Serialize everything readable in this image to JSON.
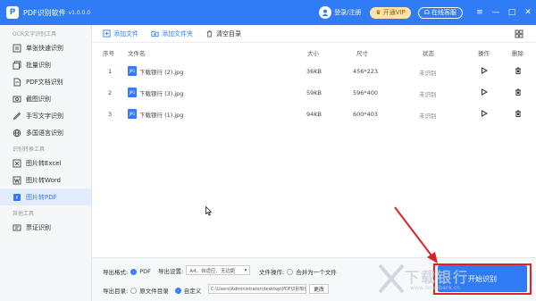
{
  "app": {
    "logo": "P",
    "title": "PDF识别软件",
    "version": "v1.0.0.0"
  },
  "titlebar": {
    "login": "登录/注册",
    "vip": "开通VIP",
    "service": "在线客服",
    "menu": "≡",
    "minimize": "—",
    "maximize": "□",
    "close": "✕"
  },
  "sidebar": {
    "group1": "OCR文字识别工具",
    "items1": [
      "单张快速识别",
      "批量识别",
      "PDF文档识别",
      "截图识别",
      "手写文字识别",
      "多国语言识别"
    ],
    "group2": "识别转换工具",
    "items2": [
      "图片转Excel",
      "图片转Word",
      "图片转PDF"
    ],
    "group3": "其他工具",
    "items3": [
      "票证识别"
    ],
    "active": "图片转PDF"
  },
  "toolbar": {
    "add_file": "添加文件",
    "add_folder": "添加文件夹",
    "clear": "清空目录"
  },
  "table": {
    "headers": {
      "index": "序号",
      "filename": "文件名",
      "size": "大小",
      "dims": "尺寸",
      "status": "状态",
      "action": "操作",
      "delete": "删除"
    },
    "icon_label": "JPG",
    "rows": [
      {
        "index": "1",
        "filename": "下载银行 (2).jpg",
        "size": "36KB",
        "dims": "456*223",
        "status": "未识别"
      },
      {
        "index": "2",
        "filename": "下载银行 (3).jpg",
        "size": "59KB",
        "dims": "596*400",
        "status": "未识别"
      },
      {
        "index": "3",
        "filename": "下载银行 (1).jpg",
        "size": "94KB",
        "dims": "600*403",
        "status": "未识别"
      }
    ]
  },
  "bottom": {
    "format_label": "导出格式:",
    "format_value": "PDF",
    "settings_label": "导出设置:",
    "settings_value": "A4、自适应、无边距",
    "file_op_label": "文件操作:",
    "merge_label": "合并为一个文件",
    "dir_label": "导出目录:",
    "orig_dir": "原文件目录",
    "custom": "自定义",
    "path": "C:\\Users\\Administrator\\desktop\\PDF识别软件",
    "change": "更改",
    "start": "开始识别"
  },
  "watermark": {
    "main": "下载银行",
    "url": "www.downbank.cn"
  },
  "colors": {
    "accent": "#2f7cf6",
    "highlight": "#e0232a",
    "vip": "#ffe3a8"
  }
}
